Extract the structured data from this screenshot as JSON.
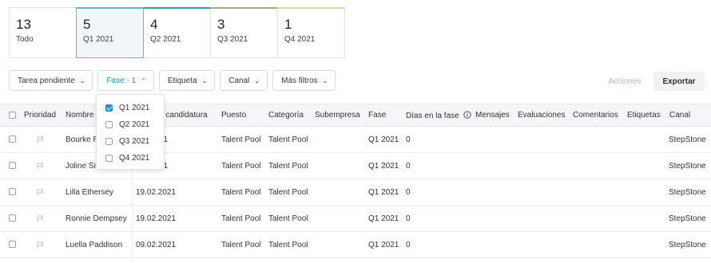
{
  "kpis": [
    {
      "value": "13",
      "label": "Todo",
      "accent": ""
    },
    {
      "value": "5",
      "label": "Q1 2021",
      "accent": "#5fb2d6"
    },
    {
      "value": "4",
      "label": "Q2 2021",
      "accent": "#3a9a93"
    },
    {
      "value": "3",
      "label": "Q3 2021",
      "accent": "#a2ad7d"
    },
    {
      "value": "1",
      "label": "Q4 2021",
      "accent": "#d5df9c"
    }
  ],
  "filters": {
    "tarea": "Tarea pendiente",
    "fase": "Fase · 1",
    "etiqueta": "Etiqueta",
    "canal": "Canal",
    "mas": "Más filtros"
  },
  "actions": {
    "acciones": "Acciones",
    "exportar": "Exportar"
  },
  "dropdown": {
    "options": [
      {
        "label": "Q1 2021",
        "checked": true
      },
      {
        "label": "Q2 2021",
        "checked": false
      },
      {
        "label": "Q3 2021",
        "checked": false
      },
      {
        "label": "Q4 2021",
        "checked": false
      }
    ]
  },
  "table": {
    "columns": {
      "prioridad": "Prioridad",
      "nombre": "Nombre",
      "fecha": "e candidatura",
      "puesto": "Puesto",
      "categoria": "Categoría",
      "subempresa": "Subempresa",
      "fase": "Fase",
      "dias": "Días en la fase",
      "mensajes": "Mensajes",
      "evaluaciones": "Evaluaciones",
      "comentarios": "Comentarios",
      "etiquetas": "Etiquetas",
      "canal": "Canal"
    },
    "rows": [
      {
        "nombre": "Bourke R",
        "fecha": "21",
        "puesto": "Talent Pool",
        "categoria": "Talent Pool",
        "fase": "Q1 2021",
        "dias": "0",
        "canal": "StepStone"
      },
      {
        "nombre": "Joline Sic",
        "fecha": "21",
        "puesto": "Talent Pool",
        "categoria": "Talent Pool",
        "fase": "Q1 2021",
        "dias": "0",
        "canal": "StepStone"
      },
      {
        "nombre": "Lilla Ethersey",
        "fecha": "19.02.2021",
        "puesto": "Talent Pool",
        "categoria": "Talent Pool",
        "fase": "Q1 2021",
        "dias": "0",
        "canal": "StepStone"
      },
      {
        "nombre": "Ronnie Dempsey",
        "fecha": "19.02.2021",
        "puesto": "Talent Pool",
        "categoria": "Talent Pool",
        "fase": "Q1 2021",
        "dias": "0",
        "canal": "StepStone"
      },
      {
        "nombre": "Luella Paddison",
        "fecha": "09.02.2021",
        "puesto": "Talent Pool",
        "categoria": "Talent Pool",
        "fase": "Q1 2021",
        "dias": "0",
        "canal": "StepStone"
      }
    ]
  },
  "icons": {
    "flag": "flag-icon",
    "info": "info-icon",
    "chevron": "chevron-down-icon",
    "check": "check-icon"
  }
}
